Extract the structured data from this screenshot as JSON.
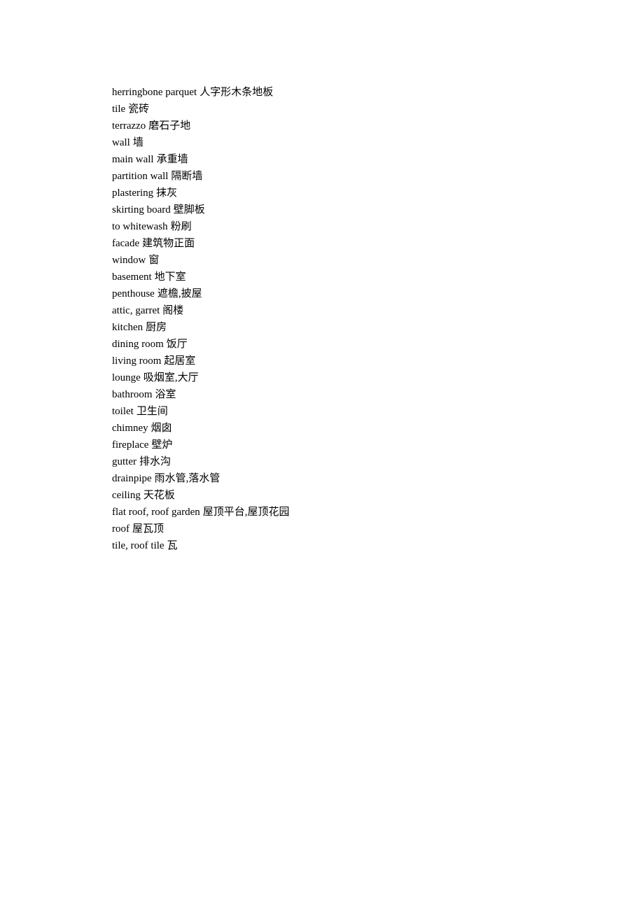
{
  "entries": [
    {
      "en": "herringbone parquet",
      "zh": "人字形木条地板"
    },
    {
      "en": "tile",
      "zh": "瓷砖"
    },
    {
      "en": "terrazzo",
      "zh": "磨石子地"
    },
    {
      "en": "wall",
      "zh": "墙"
    },
    {
      "en": "main wall",
      "zh": "承重墙"
    },
    {
      "en": "partition wall",
      "zh": "隔断墙"
    },
    {
      "en": "plastering",
      "zh": "抹灰"
    },
    {
      "en": "skirting board",
      "zh": "壁脚板"
    },
    {
      "en": "to whitewash",
      "zh": "粉刷"
    },
    {
      "en": "facade",
      "zh": "建筑物正面"
    },
    {
      "en": "window",
      "zh": "窗"
    },
    {
      "en": "basement",
      "zh": "地下室"
    },
    {
      "en": "penthouse",
      "zh": "遮檐,披屋"
    },
    {
      "en": "attic, garret",
      "zh": "阁楼"
    },
    {
      "en": "kitchen",
      "zh": "厨房"
    },
    {
      "en": "dining room",
      "zh": "饭厅"
    },
    {
      "en": "living room",
      "zh": "起居室"
    },
    {
      "en": "lounge",
      "zh": "吸烟室,大厅"
    },
    {
      "en": "bathroom",
      "zh": "浴室"
    },
    {
      "en": "toilet",
      "zh": "卫生间"
    },
    {
      "en": "chimney",
      "zh": "烟囱"
    },
    {
      "en": "fireplace",
      "zh": "壁炉"
    },
    {
      "en": "gutter",
      "zh": "排水沟"
    },
    {
      "en": "drainpipe",
      "zh": "雨水管,落水管"
    },
    {
      "en": "ceiling",
      "zh": "天花板"
    },
    {
      "en": "flat roof, roof garden",
      "zh": "屋顶平台,屋顶花园"
    },
    {
      "en": "roof",
      "zh": "屋瓦顶"
    },
    {
      "en": "tile, roof tile",
      "zh": "瓦"
    }
  ]
}
